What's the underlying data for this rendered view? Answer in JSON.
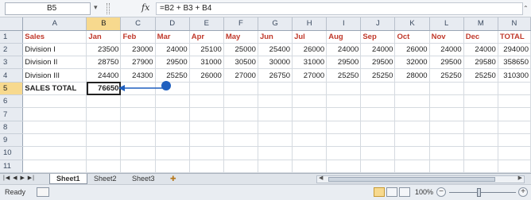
{
  "formula_bar": {
    "name_box": "B5",
    "fx_label": "fx",
    "formula": "=B2 + B3 + B4"
  },
  "columns": [
    "A",
    "B",
    "C",
    "D",
    "E",
    "F",
    "G",
    "H",
    "I",
    "J",
    "K",
    "L",
    "M",
    "N"
  ],
  "rows": [
    {
      "num": "1",
      "cells": [
        "Sales",
        "Jan",
        "Feb",
        "Mar",
        "Apr",
        "May",
        "Jun",
        "Jul",
        "Aug",
        "Sep",
        "Oct",
        "Nov",
        "Dec",
        "TOTAL"
      ]
    },
    {
      "num": "2",
      "cells": [
        "Division I",
        "23500",
        "23000",
        "24000",
        "25100",
        "25000",
        "25400",
        "26000",
        "24000",
        "24000",
        "26000",
        "24000",
        "24000",
        "294000"
      ]
    },
    {
      "num": "3",
      "cells": [
        "Division II",
        "28750",
        "27900",
        "29500",
        "31000",
        "30500",
        "30000",
        "31000",
        "29500",
        "29500",
        "32000",
        "29500",
        "29580",
        "358650"
      ]
    },
    {
      "num": "4",
      "cells": [
        "Division III",
        "24400",
        "24300",
        "25250",
        "26000",
        "27000",
        "26750",
        "27000",
        "25250",
        "25250",
        "28000",
        "25250",
        "25250",
        "310300"
      ]
    },
    {
      "num": "5",
      "cells": [
        "SALES TOTAL",
        "76650",
        "",
        "",
        "",
        "",
        "",
        "",
        "",
        "",
        "",
        "",
        "",
        ""
      ]
    },
    {
      "num": "6",
      "cells": [
        "",
        "",
        "",
        "",
        "",
        "",
        "",
        "",
        "",
        "",
        "",
        "",
        "",
        ""
      ]
    },
    {
      "num": "7",
      "cells": [
        "",
        "",
        "",
        "",
        "",
        "",
        "",
        "",
        "",
        "",
        "",
        "",
        "",
        ""
      ]
    },
    {
      "num": "8",
      "cells": [
        "",
        "",
        "",
        "",
        "",
        "",
        "",
        "",
        "",
        "",
        "",
        "",
        "",
        ""
      ]
    },
    {
      "num": "9",
      "cells": [
        "",
        "",
        "",
        "",
        "",
        "",
        "",
        "",
        "",
        "",
        "",
        "",
        "",
        ""
      ]
    },
    {
      "num": "10",
      "cells": [
        "",
        "",
        "",
        "",
        "",
        "",
        "",
        "",
        "",
        "",
        "",
        "",
        "",
        ""
      ]
    },
    {
      "num": "11",
      "cells": [
        "",
        "",
        "",
        "",
        "",
        "",
        "",
        "",
        "",
        "",
        "",
        "",
        "",
        ""
      ]
    }
  ],
  "sheet_tabs": [
    {
      "label": "Sheet1",
      "active": true
    },
    {
      "label": "Sheet2",
      "active": false
    },
    {
      "label": "Sheet3",
      "active": false
    }
  ],
  "status": {
    "ready": "Ready",
    "zoom": "100%",
    "zoom_level_percent": 100
  },
  "colors": {
    "header_text_red": "#c0392b",
    "callout_blue": "#1f5fbf",
    "selected_header": "#f7d98e"
  }
}
